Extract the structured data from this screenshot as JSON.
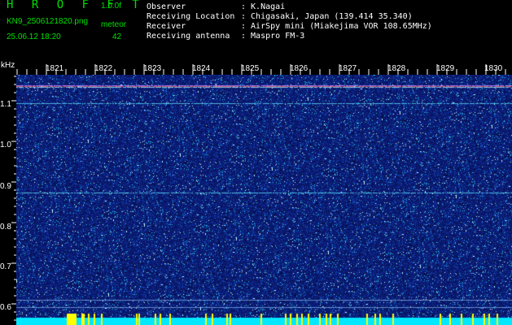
{
  "header": {
    "app_title": "H R O F F T",
    "app_version": "1.0.0f",
    "file_name": "KN9_2506121820.png",
    "meteor_label": "meteor",
    "date_time": "25.06.12 18:20",
    "meteor_count": "42"
  },
  "info": [
    {
      "key": "Observer",
      "value": ": K.Nagai"
    },
    {
      "key": "Receiving Location",
      "value": ": Chigasaki, Japan (139.414 35.340)"
    },
    {
      "key": "Receiver",
      "value": ": AirSpy mini (Miakejima VOR 108.65MHz)"
    },
    {
      "key": "Receiving antenna",
      "value": ": Maspro FM-3"
    }
  ],
  "axis": {
    "y_unit": "kHz",
    "y_ticks": [
      "1.1",
      "1.0",
      "0.9",
      "0.8",
      "0.7",
      "0.6"
    ],
    "x_ticks": [
      "1821",
      "1822",
      "1823",
      "1824",
      "1825",
      "1826",
      "1827",
      "1828",
      "1829",
      "1830"
    ]
  },
  "colors": {
    "header_green": "#00e000",
    "background_noise": "#0a1d73",
    "signal_cyan": "#00ffff",
    "marker_yellow": "#ffff00"
  }
}
